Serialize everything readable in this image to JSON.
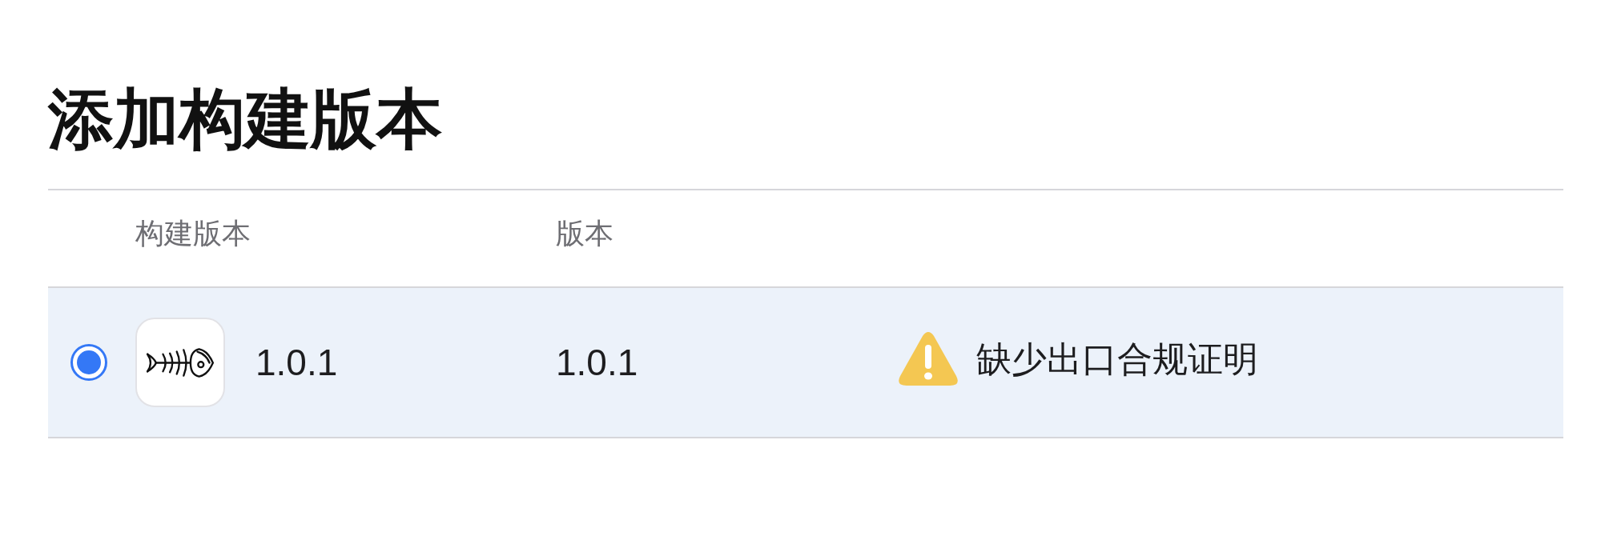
{
  "title": "添加构建版本",
  "table": {
    "columns": [
      {
        "label": "构建版本"
      },
      {
        "label": "版本"
      }
    ],
    "rows": [
      {
        "selected": true,
        "build": "1.0.1",
        "version": "1.0.1",
        "status": {
          "kind": "warning",
          "text": "缺少出口合规证明"
        }
      }
    ]
  }
}
